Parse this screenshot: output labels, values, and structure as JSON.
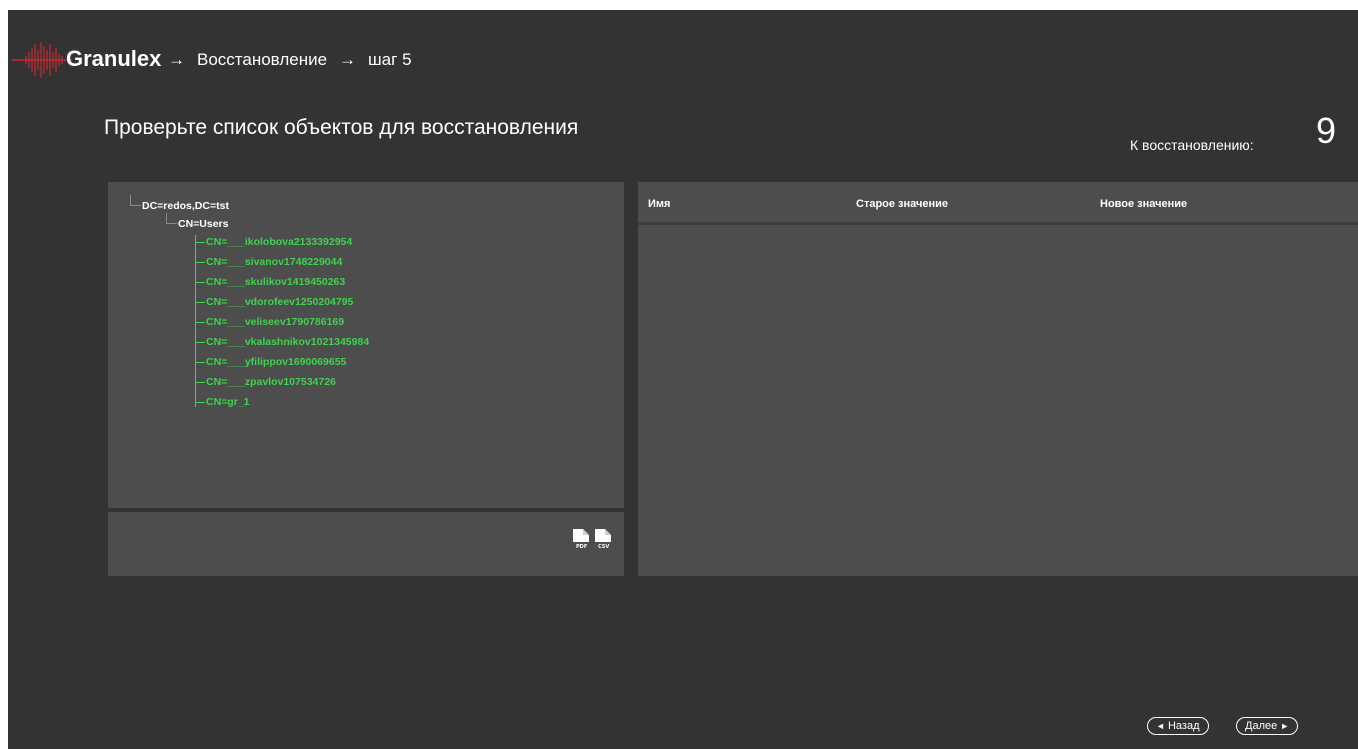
{
  "header": {
    "logo_text": "Granulex",
    "crumbs": [
      "Восстановление",
      "шаг 5"
    ],
    "arrow_symbol": "→"
  },
  "page": {
    "title": "Проверьте список объектов для восстановления",
    "count_label": "К восстановлению:",
    "count_value": "9"
  },
  "tree": {
    "root": "DC=redos,DC=tst",
    "container": "CN=Users",
    "items": [
      "CN=___ikolobova2133392954",
      "CN=___sivanov1748229044",
      "CN=___skulikov1419450263",
      "CN=___vdorofeev1250204795",
      "CN=___veliseev1790786169",
      "CN=___vkalashnikov1021345984",
      "CN=___yfilippov1690069655",
      "CN=___zpavlov107534726",
      "CN=gr_1"
    ]
  },
  "export": {
    "pdf_label": "PDF",
    "csv_label": "CSV"
  },
  "table": {
    "columns": [
      "Имя",
      "Старое значение",
      "Новое значение"
    ]
  },
  "footer": {
    "back_label": "Назад",
    "next_label": "Далее",
    "back_icon": "◄",
    "next_icon": "►"
  },
  "colors": {
    "background": "#333333",
    "panel": "#4d4d4d",
    "accent_green": "#3fd14f",
    "logo_red": "#c8282d"
  }
}
